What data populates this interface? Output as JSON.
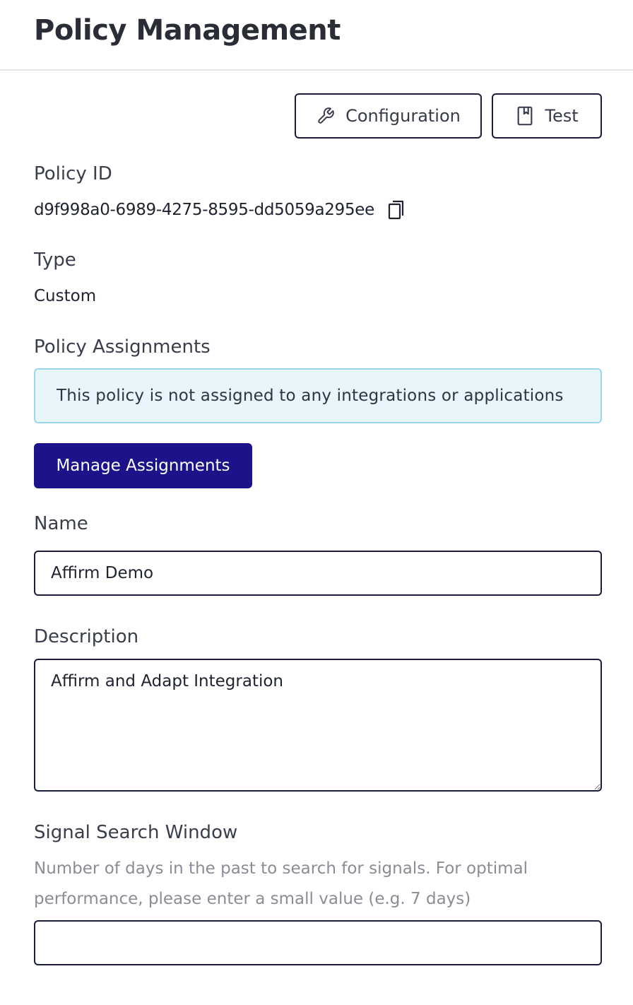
{
  "header": {
    "title": "Policy Management"
  },
  "toolbar": {
    "configuration_label": "Configuration",
    "configuration_icon": "wrench-icon",
    "test_label": "Test",
    "test_icon": "book-icon"
  },
  "policy_id": {
    "label": "Policy ID",
    "value": "d9f998a0-6989-4275-8595-dd5059a295ee",
    "copy_icon": "copy-icon"
  },
  "type": {
    "label": "Type",
    "value": "Custom"
  },
  "assignments": {
    "label": "Policy Assignments",
    "alert_text": "This policy is not assigned to any integrations or applications",
    "manage_button_label": "Manage Assignments"
  },
  "name": {
    "label": "Name",
    "value": "Affirm Demo"
  },
  "description": {
    "label": "Description",
    "value": "Affirm and Adapt Integration"
  },
  "signal_search_window": {
    "label": "Signal Search Window",
    "help_text": "Number of days in the past to search for signals. For optimal performance, please enter a small value (e.g. 7 days)",
    "value": ""
  },
  "colors": {
    "primary_button": "#1c138a",
    "alert_background": "#e8f6fc",
    "alert_border": "#9bd5ef",
    "border": "#1a1d3a"
  }
}
